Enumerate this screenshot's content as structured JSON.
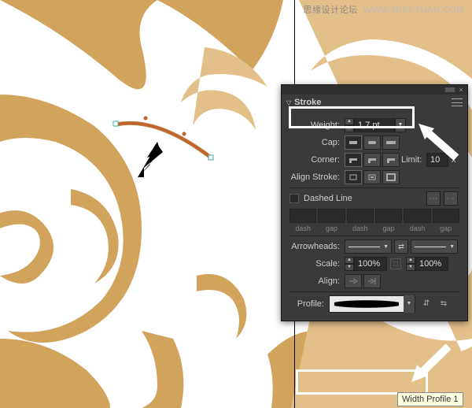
{
  "watermark": {
    "cn": "思缘设计论坛",
    "en": "WWW.MISSYUAN.COM"
  },
  "panel": {
    "title": "Stroke",
    "weight": {
      "label": "Weight:",
      "value": "1,7 pt"
    },
    "cap": {
      "label": "Cap:"
    },
    "corner": {
      "label": "Corner:",
      "limit_label": "Limit:",
      "limit_value": "10",
      "x": "x"
    },
    "align": {
      "label": "Align Stroke:"
    },
    "dashed": {
      "label": "Dashed Line",
      "slots": [
        "dash",
        "gap",
        "dash",
        "gap",
        "dash",
        "gap"
      ]
    },
    "arrowheads": {
      "label": "Arrowheads:"
    },
    "scale": {
      "label": "Scale:",
      "v1": "100%",
      "v2": "100%"
    },
    "align2": {
      "label": "Align:"
    },
    "profile": {
      "label": "Profile:"
    }
  },
  "tooltip": "Width Profile 1"
}
